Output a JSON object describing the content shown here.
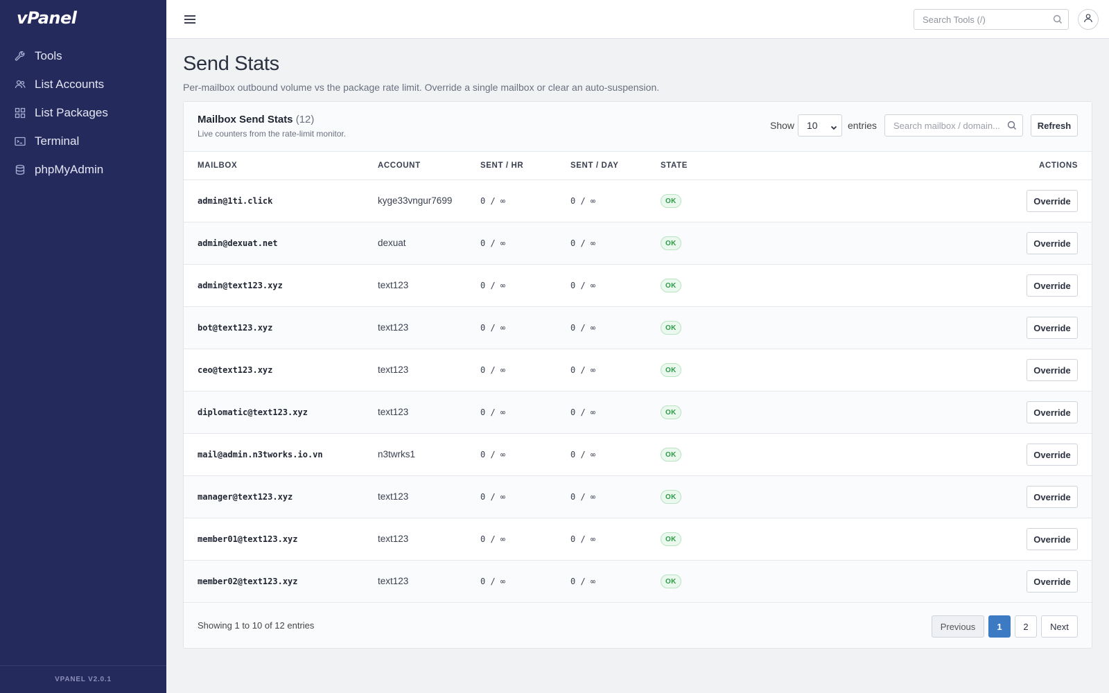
{
  "app": {
    "logo": "vPanel",
    "version": "VPANEL V2.0.1"
  },
  "sidebar": {
    "items": [
      {
        "label": "Tools",
        "icon": "wrench-icon"
      },
      {
        "label": "List Accounts",
        "icon": "users-icon"
      },
      {
        "label": "List Packages",
        "icon": "grid-icon"
      },
      {
        "label": "Terminal",
        "icon": "terminal-icon"
      },
      {
        "label": "phpMyAdmin",
        "icon": "database-icon"
      }
    ]
  },
  "topbar": {
    "search_placeholder": "Search Tools (/)"
  },
  "page": {
    "title": "Send Stats",
    "subtitle": "Per-mailbox outbound volume vs the package rate limit. Override a single mailbox or clear an auto-suspension."
  },
  "card": {
    "title": "Mailbox Send Stats",
    "count": "(12)",
    "description": "Live counters from the rate-limit monitor.",
    "show_label": "Show",
    "page_size": "10",
    "entries_label": "entries",
    "search_placeholder": "Search mailbox / domain...",
    "refresh_label": "Refresh"
  },
  "table": {
    "columns": [
      "MAILBOX",
      "ACCOUNT",
      "SENT / HR",
      "SENT / DAY",
      "STATE",
      "ACTIONS"
    ],
    "rows": [
      {
        "mailbox": "admin@1ti.click",
        "account": "kyge33vngur7699",
        "sent_hr": "0 / ∞",
        "sent_day": "0 / ∞",
        "state": "OK",
        "action": "Override"
      },
      {
        "mailbox": "admin@dexuat.net",
        "account": "dexuat",
        "sent_hr": "0 / ∞",
        "sent_day": "0 / ∞",
        "state": "OK",
        "action": "Override"
      },
      {
        "mailbox": "admin@text123.xyz",
        "account": "text123",
        "sent_hr": "0 / ∞",
        "sent_day": "0 / ∞",
        "state": "OK",
        "action": "Override"
      },
      {
        "mailbox": "bot@text123.xyz",
        "account": "text123",
        "sent_hr": "0 / ∞",
        "sent_day": "0 / ∞",
        "state": "OK",
        "action": "Override"
      },
      {
        "mailbox": "ceo@text123.xyz",
        "account": "text123",
        "sent_hr": "0 / ∞",
        "sent_day": "0 / ∞",
        "state": "OK",
        "action": "Override"
      },
      {
        "mailbox": "diplomatic@text123.xyz",
        "account": "text123",
        "sent_hr": "0 / ∞",
        "sent_day": "0 / ∞",
        "state": "OK",
        "action": "Override"
      },
      {
        "mailbox": "mail@admin.n3tworks.io.vn",
        "account": "n3twrks1",
        "sent_hr": "0 / ∞",
        "sent_day": "0 / ∞",
        "state": "OK",
        "action": "Override"
      },
      {
        "mailbox": "manager@text123.xyz",
        "account": "text123",
        "sent_hr": "0 / ∞",
        "sent_day": "0 / ∞",
        "state": "OK",
        "action": "Override"
      },
      {
        "mailbox": "member01@text123.xyz",
        "account": "text123",
        "sent_hr": "0 / ∞",
        "sent_day": "0 / ∞",
        "state": "OK",
        "action": "Override"
      },
      {
        "mailbox": "member02@text123.xyz",
        "account": "text123",
        "sent_hr": "0 / ∞",
        "sent_day": "0 / ∞",
        "state": "OK",
        "action": "Override"
      }
    ]
  },
  "footer": {
    "showing": "Showing 1 to 10 of 12 entries",
    "previous": "Previous",
    "pages": [
      "1",
      "2"
    ],
    "current_page": "1",
    "next": "Next"
  },
  "colors": {
    "sidebar_bg": "#252a5c",
    "accent": "#3c7bc4",
    "ok_badge": "#2f9a4a"
  }
}
